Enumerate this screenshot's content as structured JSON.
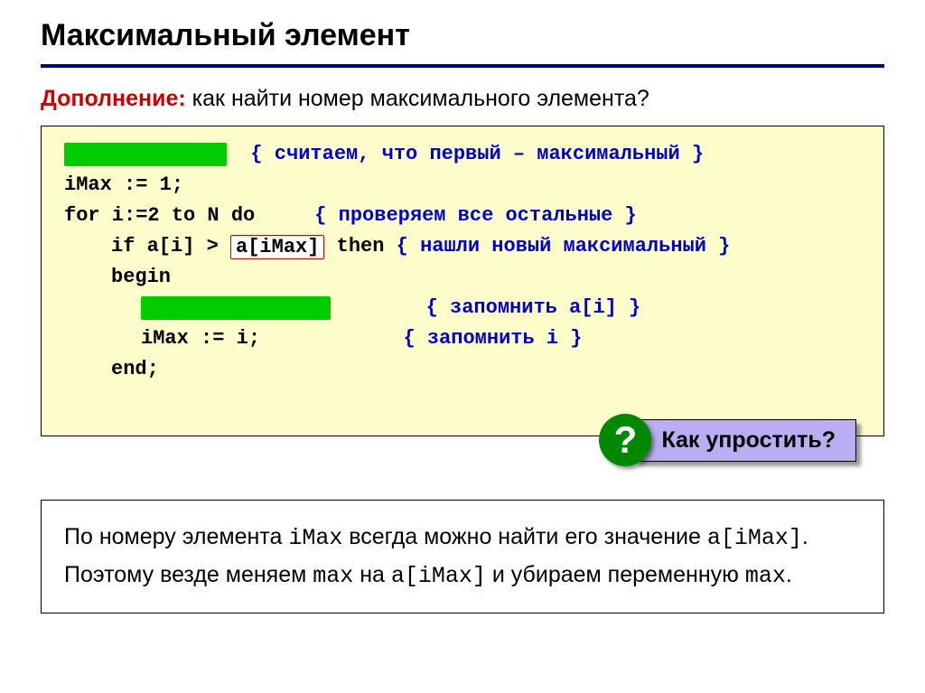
{
  "title": "Максимальный элемент",
  "subtitle": {
    "label": "Дополнение:",
    "text": " как найти номер максимального элемента?"
  },
  "code": {
    "c1_comment": "{ считаем, что первый – максимальный }",
    "c2": "iMax := 1;",
    "c3_text": "for i:=2 to N do     ",
    "c3_comment": "{ проверяем все остальные }",
    "c4_pre": "if a[i] > ",
    "c4_box": "a[iMax]",
    "c4_post": " then ",
    "c4_comment": "{ нашли новый максимальный }",
    "c5": "begin",
    "c6_comment": "{ запомнить a[i] }",
    "c7_text": "iMax := i;            ",
    "c7_comment": "{ запомнить i }",
    "c8": "end;"
  },
  "question": "Как упростить?",
  "note": {
    "p1_a": "По номеру элемента ",
    "p1_b": "iMax",
    "p1_c": " всегда можно найти его значение ",
    "p1_d": "a[iMax]",
    "p1_e": ". Поэтому везде меняем ",
    "p1_f": "max",
    "p1_g": " на ",
    "p1_h": "a[iMax]",
    "p1_i": " и убираем переменную ",
    "p1_j": "max",
    "p1_k": "."
  }
}
